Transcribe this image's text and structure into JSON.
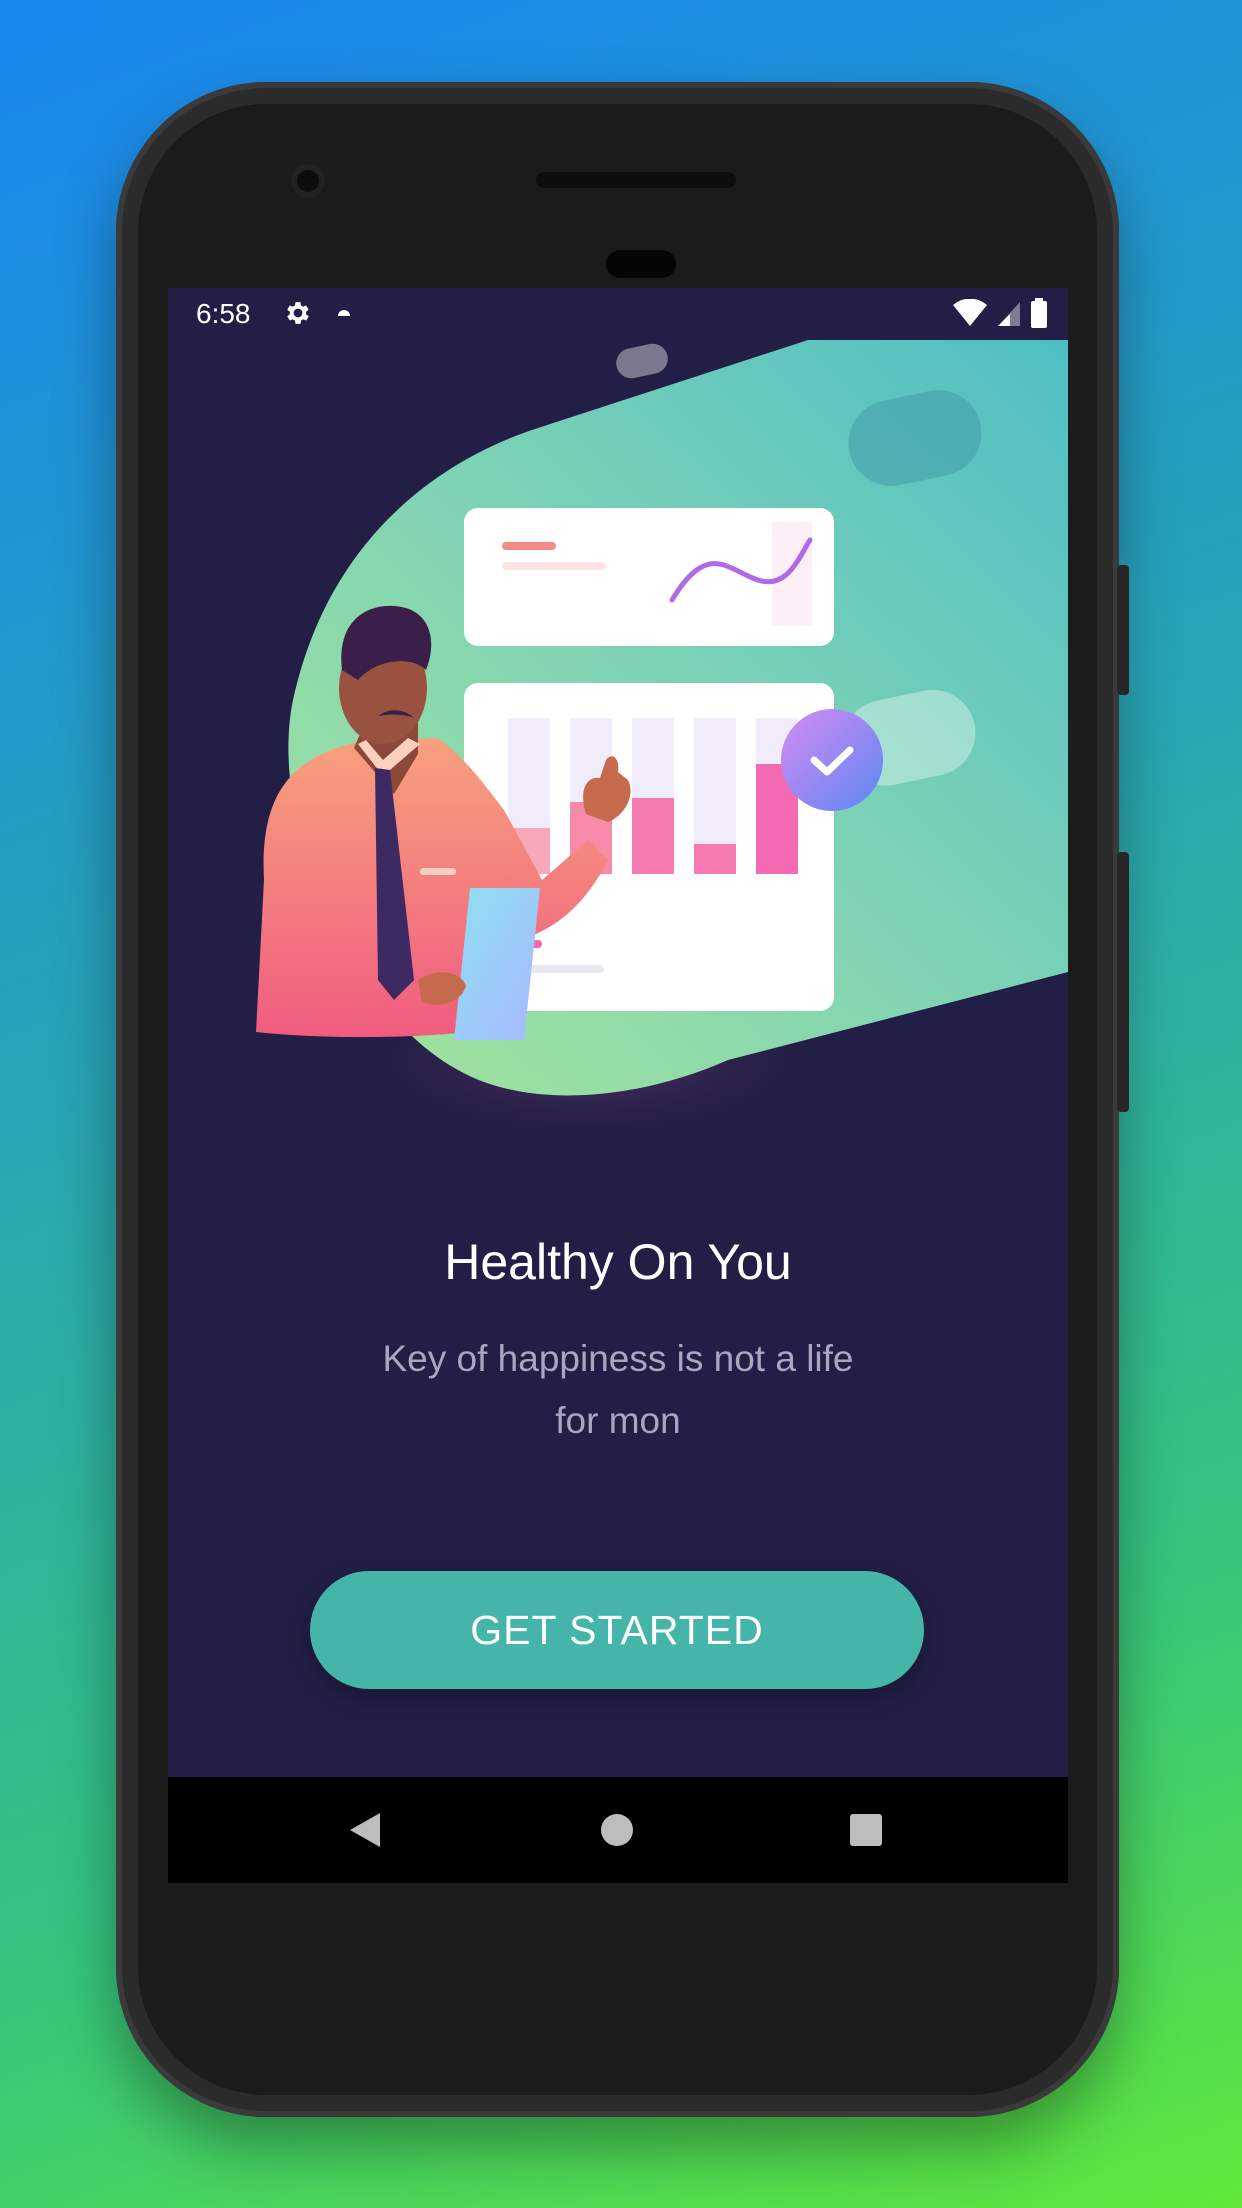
{
  "status_bar": {
    "time": "6:58",
    "icons": [
      "gear-icon",
      "notification-dot-icon",
      "wifi-icon",
      "signal-icon",
      "battery-icon"
    ]
  },
  "onboarding": {
    "title": "Healthy On You",
    "subtitle": "Key of happiness is not a life for mon",
    "cta_label": "GET STARTED"
  },
  "nav_bar": {
    "icons": [
      "back-icon",
      "home-icon",
      "recents-icon"
    ]
  },
  "colors": {
    "screen_background": "#221e45",
    "accent": "#45b5a9",
    "title_text": "#ffffff",
    "subtitle_text": "#a9a6c0"
  }
}
